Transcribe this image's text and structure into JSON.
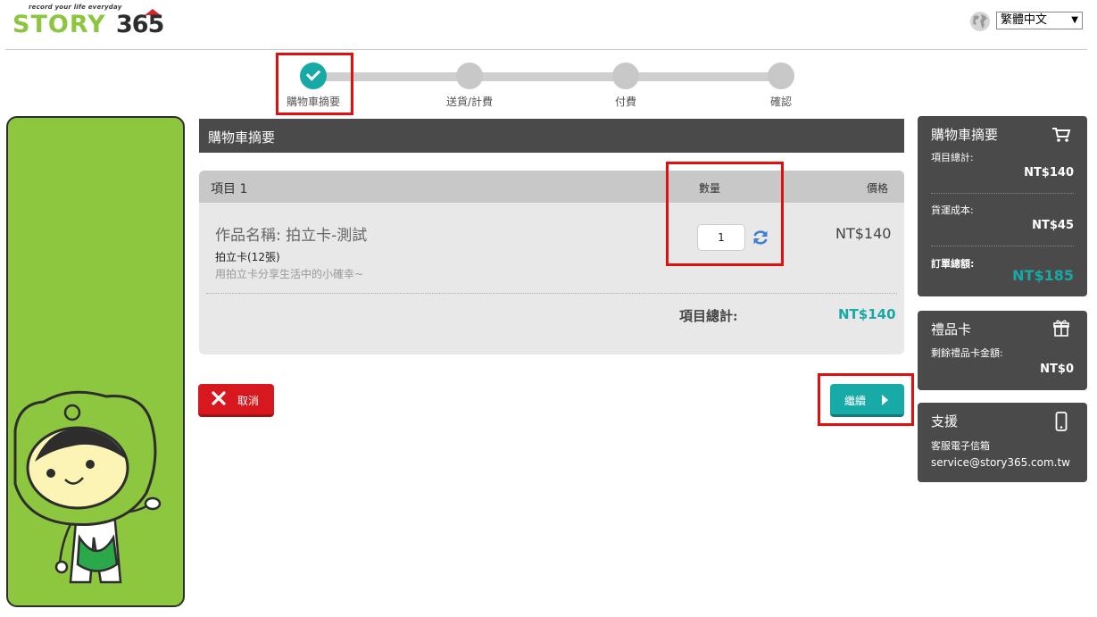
{
  "header": {
    "logo_tagline": "record your life everyday",
    "logo_word": "STORY",
    "logo_number": "365",
    "language": "繁體中文"
  },
  "steps": [
    {
      "label": "購物車摘要",
      "done": true
    },
    {
      "label": "送貨/計費",
      "done": false
    },
    {
      "label": "付費",
      "done": false
    },
    {
      "label": "確認",
      "done": false
    }
  ],
  "main": {
    "title": "購物車摘要",
    "table_headers": {
      "item": "項目 1",
      "qty": "數量",
      "price": "價格"
    },
    "item": {
      "name": "作品名稱: 拍立卡-測試",
      "type": "拍立卡(12張)",
      "desc": "用拍立卡分享生活中的小確幸~",
      "qty": "1",
      "price": "NT$140"
    },
    "subtotal_label": "項目總計:",
    "subtotal_value": "NT$140",
    "cancel_label": "取消",
    "continue_label": "繼續"
  },
  "sidebar": {
    "summary": {
      "title": "購物車摘要",
      "items_label": "項目總計:",
      "items_value": "NT$140",
      "shipping_label": "貨運成本:",
      "shipping_value": "NT$45",
      "total_label": "訂單總額:",
      "total_value": "NT$185"
    },
    "giftcard": {
      "title": "禮品卡",
      "balance_label": "剩餘禮品卡金額:",
      "balance_value": "NT$0"
    },
    "support": {
      "title": "支援",
      "email_label": "客服電子信箱",
      "email": "service@story365.com.tw"
    }
  },
  "colors": {
    "teal": "#17a9a5",
    "green": "#8dc63f",
    "dark": "#4a4a4a",
    "red": "#d7191f"
  }
}
